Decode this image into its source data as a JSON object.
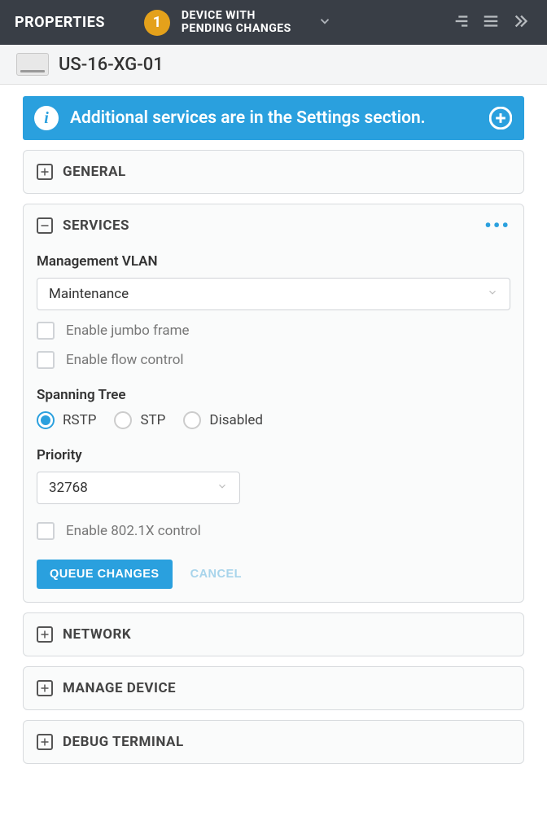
{
  "header": {
    "title": "PROPERTIES",
    "pending_count": "1",
    "pending_text_l1": "DEVICE WITH",
    "pending_text_l2": "PENDING CHANGES"
  },
  "device": {
    "name": "US-16-XG-01"
  },
  "banner": {
    "text": "Additional services are in the Settings section."
  },
  "panels": {
    "general": {
      "title": "GENERAL"
    },
    "services": {
      "title": "SERVICES",
      "mgmt_vlan_label": "Management VLAN",
      "mgmt_vlan_value": "Maintenance",
      "jumbo_label": "Enable jumbo frame",
      "flow_label": "Enable flow control",
      "spanning_label": "Spanning Tree",
      "radio_rstp": "RSTP",
      "radio_stp": "STP",
      "radio_disabled": "Disabled",
      "priority_label": "Priority",
      "priority_value": "32768",
      "dot1x_label": "Enable 802.1X control",
      "queue_btn": "QUEUE CHANGES",
      "cancel_btn": "CANCEL"
    },
    "network": {
      "title": "NETWORK"
    },
    "manage": {
      "title": "MANAGE DEVICE"
    },
    "debug": {
      "title": "DEBUG TERMINAL"
    }
  }
}
